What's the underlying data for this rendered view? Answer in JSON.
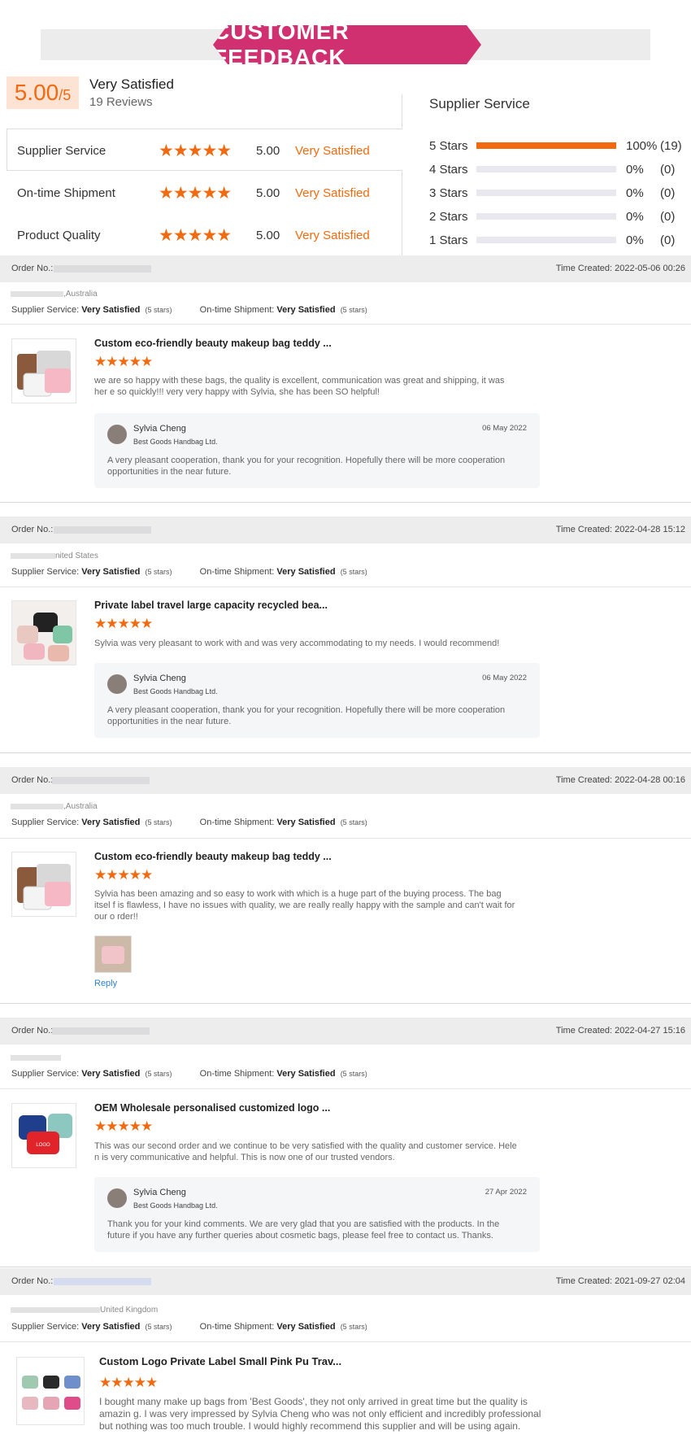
{
  "banner": {
    "title": "CUSTOMER FEEDBACK"
  },
  "overall": {
    "score": "5.00",
    "out_of": "/5",
    "label": "Very Satisfied",
    "count": "19 Reviews"
  },
  "ratings": [
    {
      "name": "Supplier Service",
      "stars": "★★★★★",
      "value": "5.00",
      "word": "Very Satisfied"
    },
    {
      "name": "On-time Shipment",
      "stars": "★★★★★",
      "value": "5.00",
      "word": "Very Satisfied"
    },
    {
      "name": "Product Quality",
      "stars": "★★★★★",
      "value": "5.00",
      "word": "Very Satisfied"
    }
  ],
  "distribution": {
    "title": "Supplier Service",
    "rows": [
      {
        "label": "5 Stars",
        "fraction": 1.0,
        "pct": "100%",
        "count": "(19)"
      },
      {
        "label": "4 Stars",
        "fraction": 0.0,
        "pct": "0%",
        "count": "(0)"
      },
      {
        "label": "3 Stars",
        "fraction": 0.0,
        "pct": "0%",
        "count": "(0)"
      },
      {
        "label": "2 Stars",
        "fraction": 0.0,
        "pct": "0%",
        "count": "(0)"
      },
      {
        "label": "1 Stars",
        "fraction": 0.0,
        "pct": "0%",
        "count": "(0)"
      }
    ]
  },
  "colors": {
    "accent": "#f26a10",
    "banner": "#d0306f",
    "link": "#2f80c8"
  },
  "labels": {
    "order_no": "Order No.:",
    "time_created": "Time Created:",
    "supplier_service": "Supplier Service:",
    "ontime_shipment": "On-time Shipment:",
    "very_satisfied": "Very Satisfied",
    "five_stars": "(5 stars)"
  },
  "reviews": [
    {
      "time": "Time Created: 2022-05-06 00:26",
      "buyer_country": ",Australia",
      "product": "Custom eco-friendly beauty makeup bag teddy ...",
      "stars": "★★★★★",
      "text": "we are so happy with these bags, the quality is excellent, communication was great and shipping, it was her e so quickly!!! very very happy with Sylvia, she has been SO helpful!",
      "reply": {
        "name": "Sylvia Cheng",
        "company": "Best Goods Handbag Ltd.",
        "date": "06 May 2022",
        "text": "A very pleasant cooperation, thank you for your recognition. Hopefully there will be more cooperation opportunities in the near future."
      }
    },
    {
      "time": "Time Created: 2022-04-28 15:12",
      "buyer_country": "nited States",
      "product": "Private label travel large capacity recycled bea...",
      "stars": "★★★★★",
      "text": "Sylvia was very pleasant to work with and was very accommodating to my needs. I would recommend!",
      "reply": {
        "name": "Sylvia Cheng",
        "company": "Best Goods Handbag Ltd.",
        "date": "06 May 2022",
        "text": "A very pleasant cooperation, thank you for your recognition. Hopefully there will be more cooperation opportunities in the near future."
      }
    },
    {
      "time": "Time Created: 2022-04-28 00:16",
      "buyer_country": ",Australia",
      "product": "Custom eco-friendly beauty makeup bag teddy ...",
      "stars": "★★★★★",
      "text": "Sylvia has been amazing and so easy to work with which is a huge part of the buying process. The bag itsel f is flawless, I have no issues with quality, we are really really happy with the sample and can't wait for our o rder!!",
      "reply_link": "Reply"
    },
    {
      "time": "Time Created: 2022-04-27 15:16",
      "buyer_country": "",
      "product": "OEM Wholesale personalised customized logo ...",
      "stars": "★★★★★",
      "text": "This was our second order and we continue to be very satisfied with the quality and customer service. Hele n is very communicative and helpful. This is now one of our trusted vendors.",
      "reply": {
        "name": "Sylvia Cheng",
        "company": "Best Goods Handbag Ltd.",
        "date": "27 Apr 2022",
        "text": "Thank you for your kind comments. We are very glad that you are satisfied with the products. In the future if you have any further queries about cosmetic bags, please feel free to contact us. Thanks."
      }
    },
    {
      "time": "Time Created: 2021-09-27 02:04",
      "buyer_country": "United Kingdom",
      "product": "Custom Logo Private Label Small Pink Pu Trav...",
      "stars": "★★★★★",
      "text": "I bought many make up bags from 'Best Goods', they not only arrived in great time but the quality is amazin g. I was very impressed by Sylvia Cheng who was not only efficient and incredibly professional but nothing was too much trouble. I would highly recommend this supplier and will be using again."
    }
  ]
}
